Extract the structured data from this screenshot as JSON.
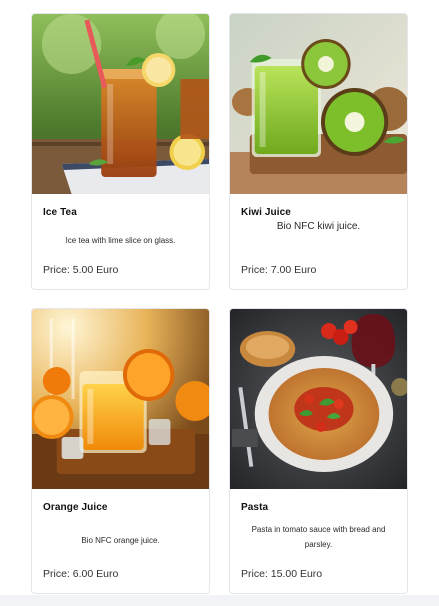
{
  "products": [
    {
      "name": "Ice Tea",
      "description": "Ice tea with lime slice on glass.",
      "price": "Price: 5.00 Euro",
      "image_icon": "ice-tea-photo"
    },
    {
      "name": "Kiwi Juice",
      "description": "Bio NFC kiwi juice.",
      "price": "Price: 7.00 Euro",
      "image_icon": "kiwi-juice-photo"
    },
    {
      "name": "Orange Juice",
      "description": "Bio NFC orange juice.",
      "price": "Price: 6.00 Euro",
      "image_icon": "orange-juice-photo"
    },
    {
      "name": "Pasta",
      "description": "Pasta in tomato sauce with bread and parsley.",
      "price": "Price: 15.00 Euro",
      "image_icon": "pasta-photo"
    }
  ],
  "colors": {
    "card_border": "#e4e6ea",
    "title_text": "#111111",
    "price_text": "#333333"
  }
}
